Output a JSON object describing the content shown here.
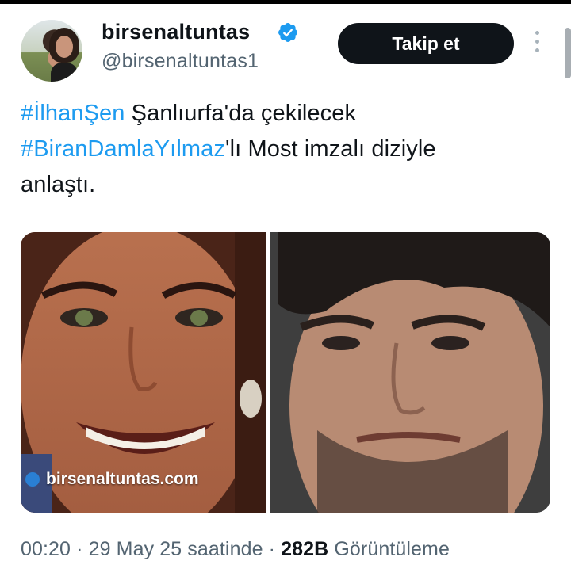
{
  "author": {
    "name": "birsenaltuntas",
    "handle": "@birsenaltuntas1",
    "verified": true,
    "verified_color": "#1d9bf0"
  },
  "follow_button": {
    "label": "Takip et"
  },
  "tweet": {
    "hashtag1": "#İlhanŞen",
    "text1": " Şanlıurfa'da çekilecek",
    "hashtag2": "#BiranDamlaYılmaz",
    "text2": "'lı Most imzalı diziyle",
    "text3": "anlaştı."
  },
  "media": {
    "watermark": "birsenaltuntas.com"
  },
  "meta": {
    "time": "00:20",
    "sep1": " · ",
    "date": "29 May 25 saatinde",
    "sep2": " · ",
    "views_count": "282B",
    "views_label": " Görüntüleme"
  },
  "colors": {
    "link": "#1d9bf0",
    "text": "#0f1419",
    "secondary": "#536471",
    "button_bg": "#0f1419"
  },
  "icons": [
    "verified-badge-icon",
    "more-options-icon"
  ]
}
